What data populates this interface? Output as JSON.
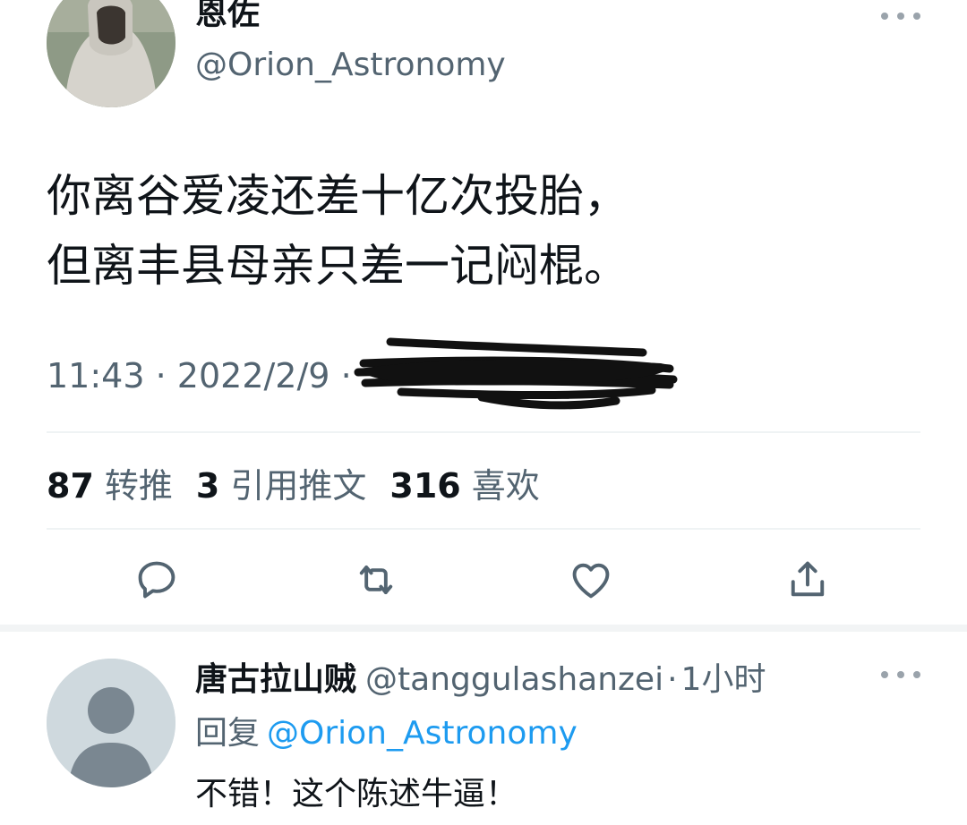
{
  "tweet": {
    "display_name": "恩佐",
    "handle": "@Orion_Astronomy",
    "text": "你离谷爱凌还差十亿次投胎，\n但离丰县母亲只差一记闷棍。",
    "time": "11:43",
    "separator": "·",
    "date": "2022/2/9",
    "stats": [
      {
        "count": "87",
        "label": "转推"
      },
      {
        "count": "3",
        "label": "引用推文"
      },
      {
        "count": "316",
        "label": "喜欢"
      }
    ],
    "actions": [
      "reply-icon",
      "retweet-icon",
      "like-icon",
      "share-icon"
    ]
  },
  "reply": {
    "display_name": "唐古拉山贼",
    "handle": "@tanggulashanzei",
    "time": "1小时",
    "separator": "·",
    "reply_label": "回复",
    "reply_to": "@Orion_Astronomy",
    "text": "不错！这个陈述牛逼！"
  },
  "colors": {
    "text": "#0f1419",
    "secondary": "#536471",
    "link": "#1d9bf0",
    "divider": "#eff3f4"
  }
}
